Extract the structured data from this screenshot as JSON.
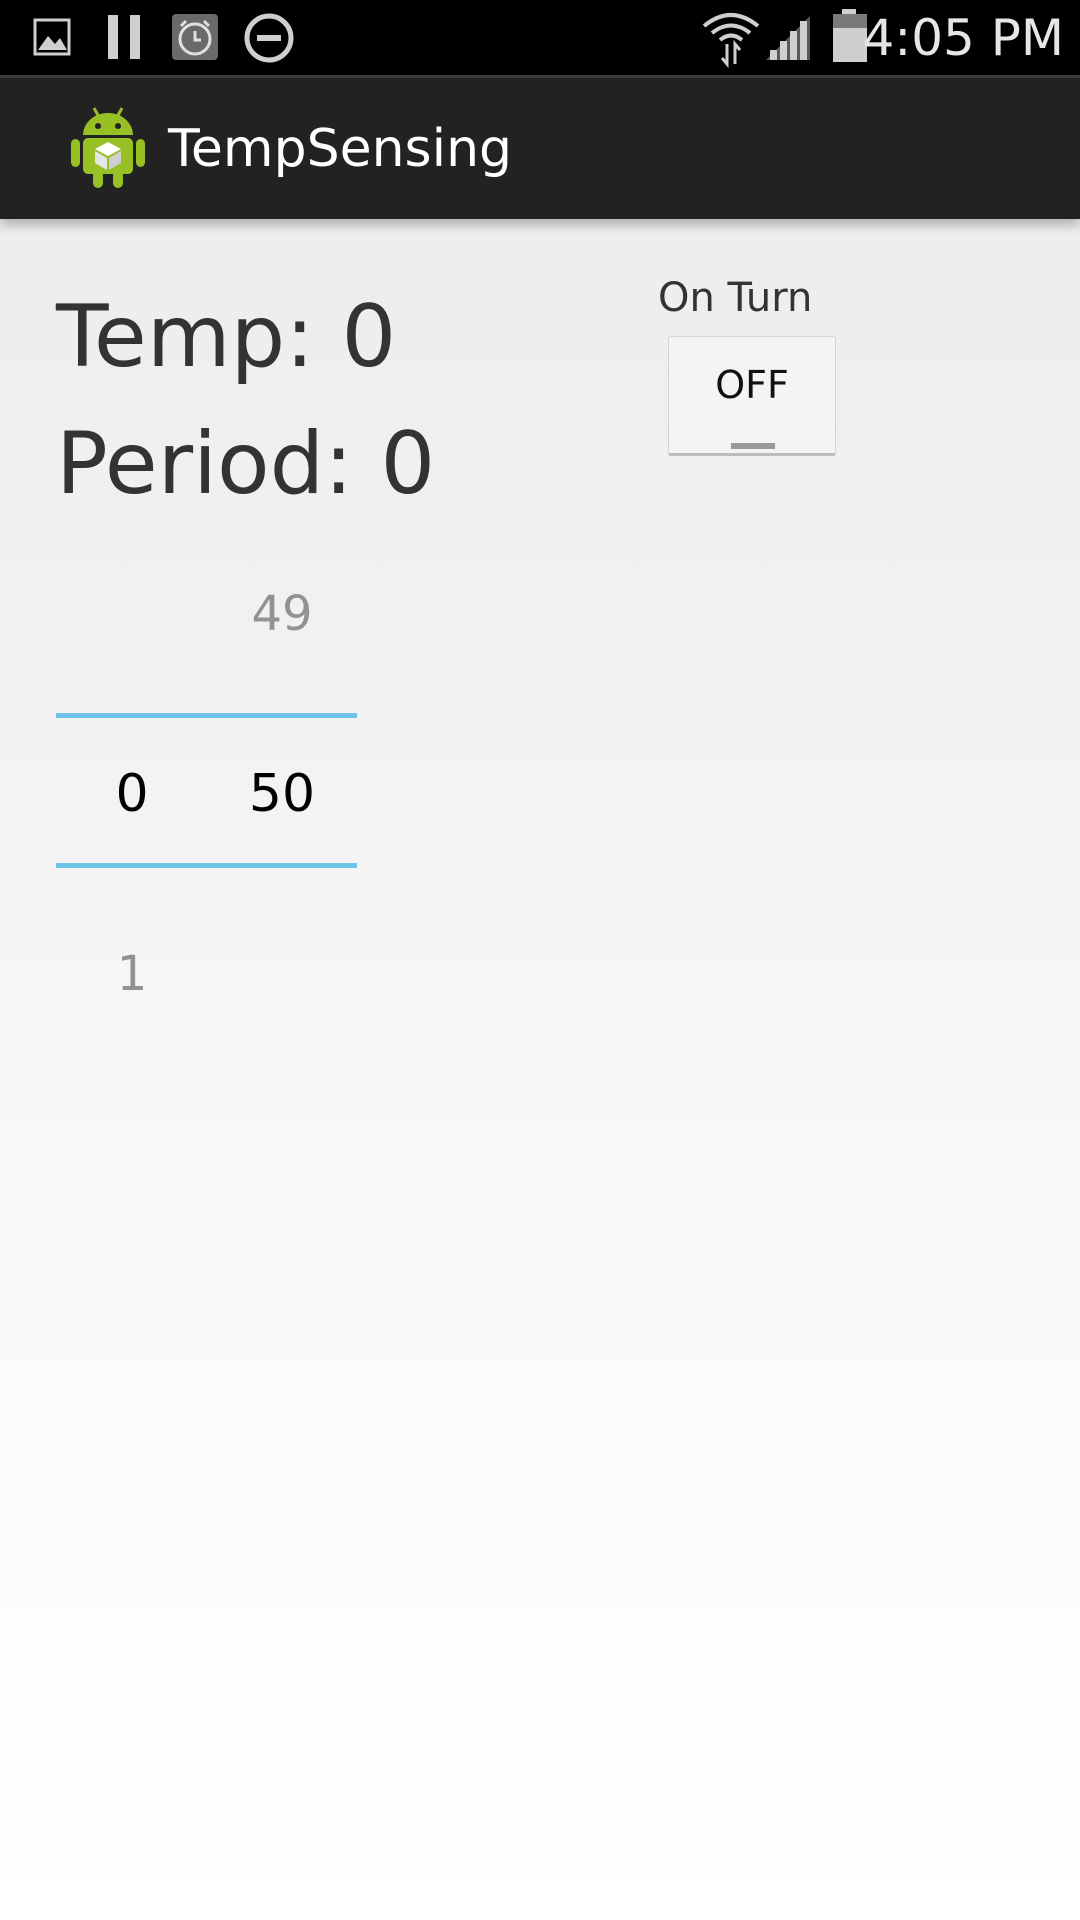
{
  "status_bar": {
    "time": "4:05 PM",
    "left_icons": [
      "image-icon",
      "pause-icon",
      "alarm-icon",
      "do-not-disturb-icon"
    ],
    "right_icons": [
      "wifi-icon",
      "signal-icon",
      "battery-icon"
    ]
  },
  "action_bar": {
    "title": "TempSensing",
    "icon": "android-app-icon"
  },
  "main": {
    "temp_label": "Temp: 0",
    "period_label": "Period: 0",
    "toggle": {
      "caption": "On Turn",
      "state_label": "OFF"
    },
    "picker_left": {
      "selected": "0",
      "next": "1"
    },
    "picker_right": {
      "previous": "49",
      "selected": "50"
    }
  },
  "colors": {
    "status_bar": "#000000",
    "action_bar": "#222222",
    "picker_divider": "#6ec4e8",
    "text_primary": "#333333"
  }
}
